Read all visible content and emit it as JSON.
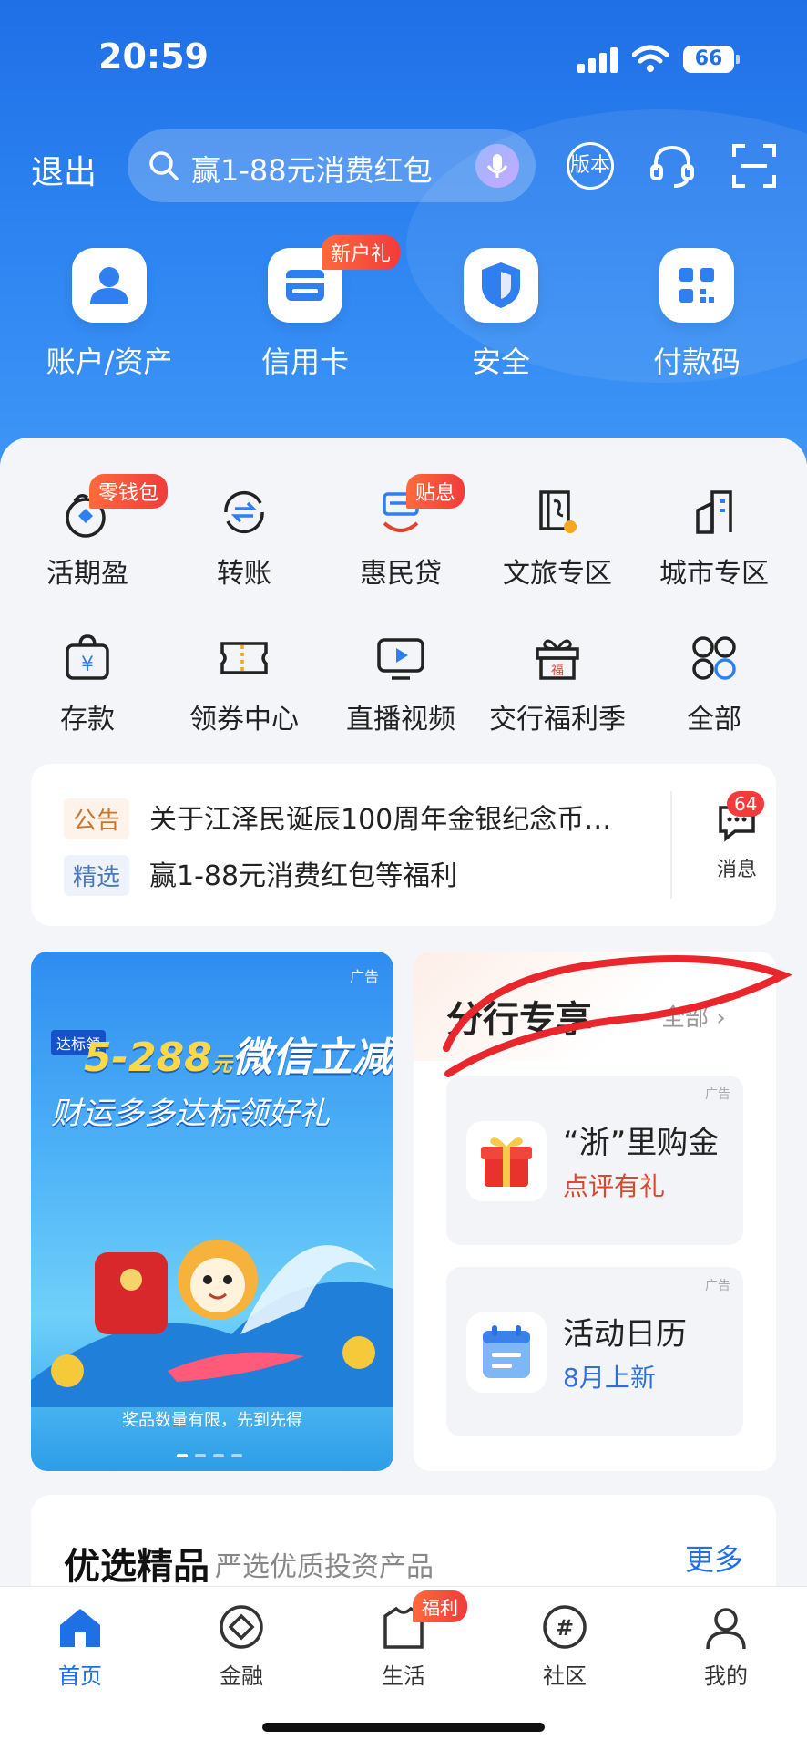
{
  "status_bar": {
    "time": "20:59",
    "battery": "66"
  },
  "top_bar": {
    "logout": "退出",
    "search_placeholder": "赢1-88元消费红包",
    "version_label": "版本"
  },
  "quick_actions": [
    {
      "label": "账户/资产",
      "icon": "user-icon"
    },
    {
      "label": "信用卡",
      "icon": "card-icon",
      "tag": "新户礼"
    },
    {
      "label": "安全",
      "icon": "shield-icon"
    },
    {
      "label": "付款码",
      "icon": "qrcode-icon"
    }
  ],
  "services": [
    {
      "label": "活期盈",
      "icon": "coin-pouch-icon",
      "tag": "零钱包"
    },
    {
      "label": "转账",
      "icon": "transfer-icon"
    },
    {
      "label": "惠民贷",
      "icon": "loan-icon",
      "tag": "贴息"
    },
    {
      "label": "文旅专区",
      "icon": "scroll-icon"
    },
    {
      "label": "城市专区",
      "icon": "building-icon"
    },
    {
      "label": "存款",
      "icon": "yuan-bag-icon"
    },
    {
      "label": "领券中心",
      "icon": "ticket-icon"
    },
    {
      "label": "直播视频",
      "icon": "play-icon"
    },
    {
      "label": "交行福利季",
      "icon": "gift-icon"
    },
    {
      "label": "全部",
      "icon": "grid-icon"
    }
  ],
  "notice": {
    "items": [
      {
        "tag": "公告",
        "text": "关于江泽民诞辰100周年金银纪念币…"
      },
      {
        "tag": "精选",
        "text": "赢1-88元消费红包等福利"
      }
    ],
    "message_label": "消息",
    "message_count": "64"
  },
  "banner": {
    "ad_mark": "广告",
    "badge": "达标领",
    "headline_amount": "5-288",
    "headline_unit": "元",
    "headline_rest": "微信立减金",
    "subline": "财运多多达标领好礼",
    "footnote": "奖品数量有限，先到先得"
  },
  "branch": {
    "title": "分行专享",
    "all_label": "全部",
    "cards": [
      {
        "ad_mark": "广告",
        "title": "“浙”里购金",
        "subtitle": "点评有礼",
        "subtitle_color": "#e2452f",
        "icon": "gift-box-icon"
      },
      {
        "ad_mark": "广告",
        "title": "活动日历",
        "subtitle": "8月上新",
        "subtitle_color": "#2f6fd8",
        "icon": "calendar-icon"
      }
    ]
  },
  "picks": {
    "title": "优选精品",
    "subtitle": "严选优质投资产品",
    "more": "更多"
  },
  "tabbar": [
    {
      "label": "首页",
      "icon": "home-icon",
      "active": true
    },
    {
      "label": "金融",
      "icon": "finance-icon"
    },
    {
      "label": "生活",
      "icon": "life-icon",
      "tag": "福利"
    },
    {
      "label": "社区",
      "icon": "community-icon"
    },
    {
      "label": "我的",
      "icon": "profile-icon"
    }
  ],
  "colors": {
    "brand": "#1f6fe6",
    "badge": "#f23b3b",
    "annotation": "#e8262c"
  }
}
